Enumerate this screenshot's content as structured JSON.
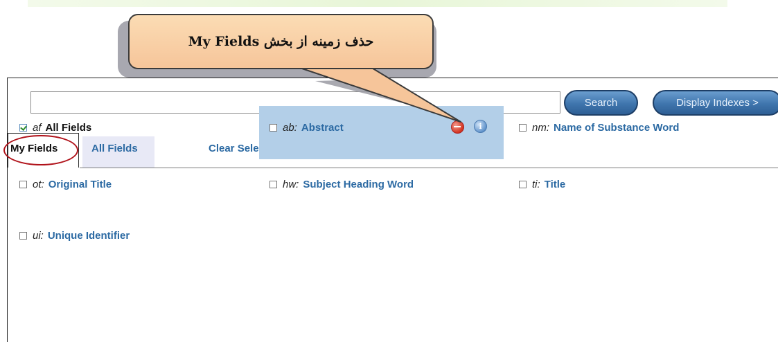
{
  "search": {
    "value": "",
    "search_button": "Search",
    "display_indexes_button": "Display Indexes >"
  },
  "tabs": {
    "my_fields": "My Fields",
    "all_fields": "All Fields",
    "clear_selected": "Clear Selected"
  },
  "fields": [
    {
      "code": "af",
      "name": "All Fields",
      "checked": true
    },
    {
      "code": "ab:",
      "name": "Abstract",
      "checked": false
    },
    {
      "code": "nm:",
      "name": "Name of Substance Word",
      "checked": false
    },
    {
      "code": "ot:",
      "name": "Original Title",
      "checked": false
    },
    {
      "code": "hw:",
      "name": "Subject Heading Word",
      "checked": false
    },
    {
      "code": "ti:",
      "name": "Title",
      "checked": false
    },
    {
      "code": "ui:",
      "name": "Unique Identifier",
      "checked": false
    }
  ],
  "callout": {
    "text": "حذف زمینه از بخش My Fields"
  },
  "colors": {
    "link": "#2c6aa3",
    "highlight": "#b3cfe8",
    "callout_fill": "#f6c59a",
    "annotation_circle": "#b0121a"
  },
  "icons": {
    "remove": "remove-circle-icon",
    "info": "info-icon"
  }
}
